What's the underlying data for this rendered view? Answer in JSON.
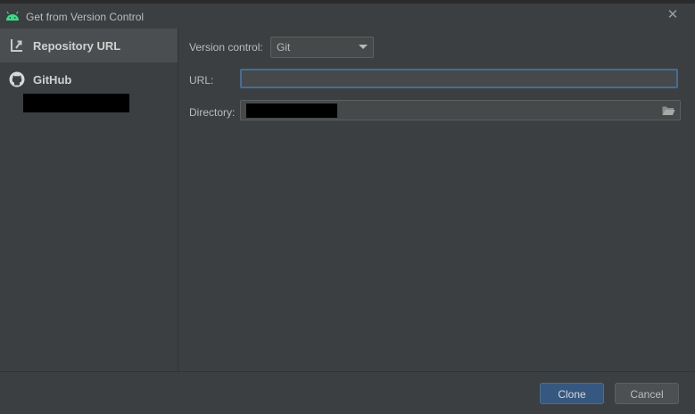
{
  "window": {
    "title": "Get from Version Control",
    "close_symbol": "✕"
  },
  "sidebar": {
    "items": [
      {
        "label": "Repository URL",
        "icon": "repository-url-icon",
        "selected": true
      },
      {
        "label": "GitHub",
        "icon": "github-icon",
        "selected": false
      }
    ]
  },
  "form": {
    "version_control_label": "Version control:",
    "version_control_value": "Git",
    "url_label": "URL:",
    "url_value": "",
    "directory_label": "Directory:"
  },
  "buttons": {
    "clone": "Clone",
    "cancel": "Cancel"
  },
  "colors": {
    "background": "#3c3f41",
    "selection": "#4b4e51",
    "focus_border": "#466d94",
    "default_button": "#365880",
    "android_green": "#3ddc84"
  }
}
